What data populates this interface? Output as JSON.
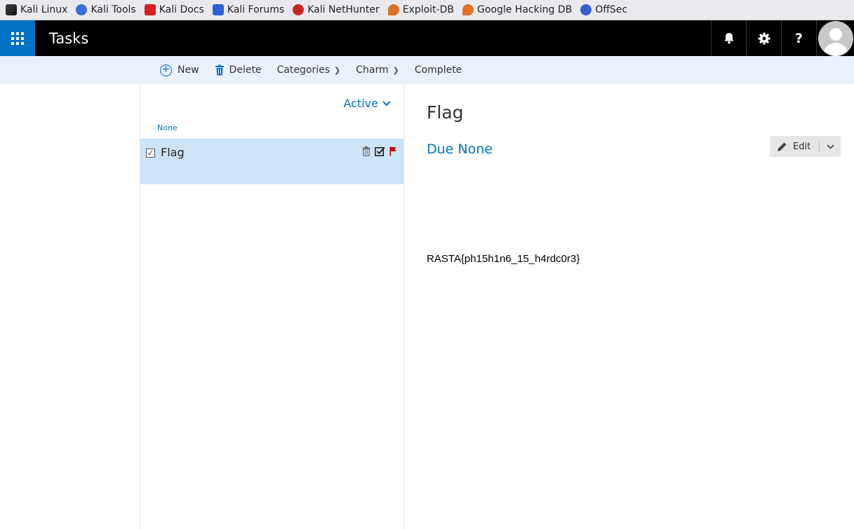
{
  "bookmarks": [
    {
      "label": "Kali Linux",
      "icon": "kali-dragon-icon",
      "color": "#333333"
    },
    {
      "label": "Kali Tools",
      "icon": "kali-tools-icon",
      "color": "#3b6fd6"
    },
    {
      "label": "Kali Docs",
      "icon": "kali-docs-icon",
      "color": "#d42020"
    },
    {
      "label": "Kali Forums",
      "icon": "kali-forums-icon",
      "color": "#2a62d4"
    },
    {
      "label": "Kali NetHunter",
      "icon": "kali-nethunter-icon",
      "color": "#c82828"
    },
    {
      "label": "Exploit-DB",
      "icon": "exploit-db-icon",
      "color": "#e0702a"
    },
    {
      "label": "Google Hacking DB",
      "icon": "ghdb-icon",
      "color": "#e0702a"
    },
    {
      "label": "OffSec",
      "icon": "offsec-icon",
      "color": "#3a5ec8"
    }
  ],
  "header": {
    "app_title": "Tasks",
    "notifications_icon": "bell-icon",
    "settings_icon": "gear-icon",
    "help_label": "?",
    "brand_color": "#0072c6"
  },
  "commands": {
    "new_label": "New",
    "delete_label": "Delete",
    "categories_label": "Categories",
    "charm_label": "Charm",
    "complete_label": "Complete"
  },
  "list": {
    "filter_label": "Active",
    "group_label": "None",
    "items": [
      {
        "title": "Flag",
        "checked": true
      }
    ]
  },
  "detail": {
    "title": "Flag",
    "due": "Due None",
    "edit_label": "Edit",
    "body_text": "RASTA{ph15h1n6_15_h4rdc0r3}"
  }
}
